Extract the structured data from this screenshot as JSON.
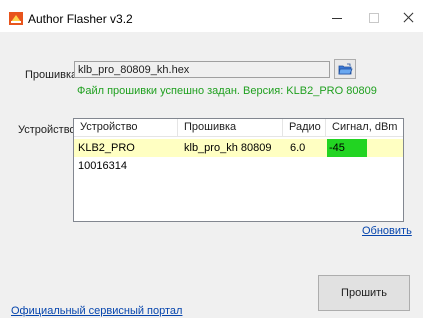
{
  "window": {
    "title": "Author Flasher v3.2",
    "icon": "author-flasher-app-icon"
  },
  "firmware": {
    "label": "Прошивка:",
    "file_value": "klb_pro_80809_kh.hex",
    "browse_icon": "open-folder-icon",
    "status": "Файл прошивки успешно задан. Версия: KLB2_PRO 80809",
    "status_color": "#20a020"
  },
  "devices": {
    "label": "Устройство:",
    "columns": [
      "Устройство",
      "Прошивка",
      "Радио",
      "Сигнал, dBm"
    ],
    "rows": [
      {
        "device": "KLB2_PRO  10016314",
        "firmware": "klb_pro_kh 80809",
        "radio": "6.0",
        "signal": "-45"
      }
    ],
    "selected_row_color": "#ffffc2",
    "signal_good_color": "#22d422",
    "refresh_label": "Обновить"
  },
  "actions": {
    "flash_label": "Прошить"
  },
  "footer": {
    "portal_link": "Официальный сервисный портал"
  }
}
